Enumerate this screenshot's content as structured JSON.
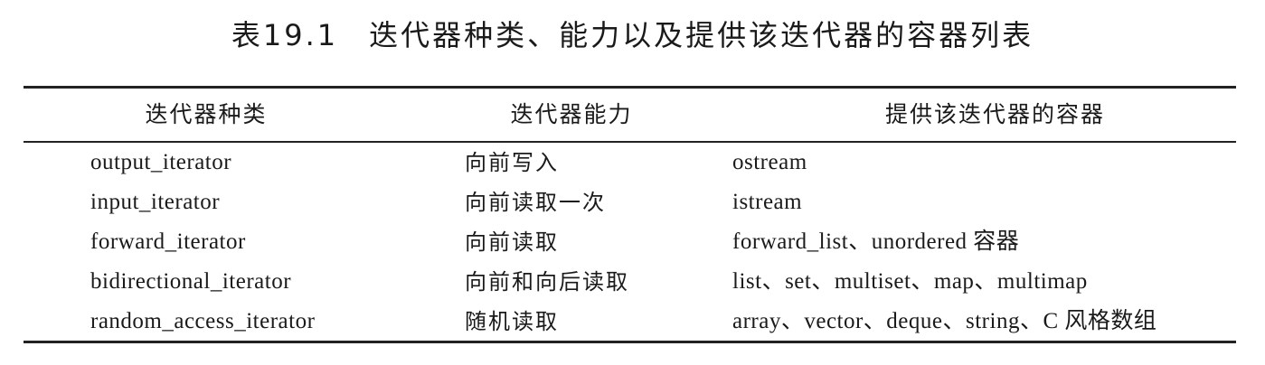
{
  "caption": {
    "number": "表19.1",
    "title": "迭代器种类、能力以及提供该迭代器的容器列表"
  },
  "table": {
    "headers": [
      "迭代器种类",
      "迭代器能力",
      "提供该迭代器的容器"
    ],
    "rows": [
      [
        "output_iterator",
        "向前写入",
        "ostream"
      ],
      [
        "input_iterator",
        "向前读取一次",
        "istream"
      ],
      [
        "forward_iterator",
        "向前读取",
        "forward_list、unordered 容器"
      ],
      [
        "bidirectional_iterator",
        "向前和向后读取",
        "list、set、multiset、map、multimap"
      ],
      [
        "random_access_iterator",
        "随机读取",
        "array、vector、deque、string、C 风格数组"
      ]
    ]
  }
}
